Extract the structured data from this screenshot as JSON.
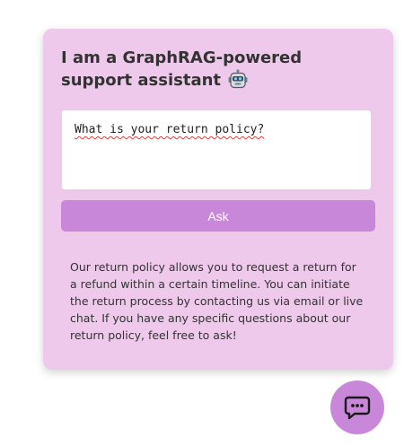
{
  "assistant": {
    "title": "I am a GraphRAG-powered support assistant",
    "title_icon": "robot-face-icon"
  },
  "query": {
    "value": "What is your return policy?"
  },
  "ask_button": {
    "label": "Ask"
  },
  "response": {
    "text": "Our return policy allows you to request a return for a refund within a certain timeline. You can initiate the return process by contacting us via email or live chat. If you have any specific questions about our return policy, feel free to ask!"
  },
  "chat_toggle": {
    "icon": "chat-bubble-icon"
  },
  "colors": {
    "panel_background": "#efc9ec",
    "accent": "#c987d9",
    "text": "#333333"
  }
}
